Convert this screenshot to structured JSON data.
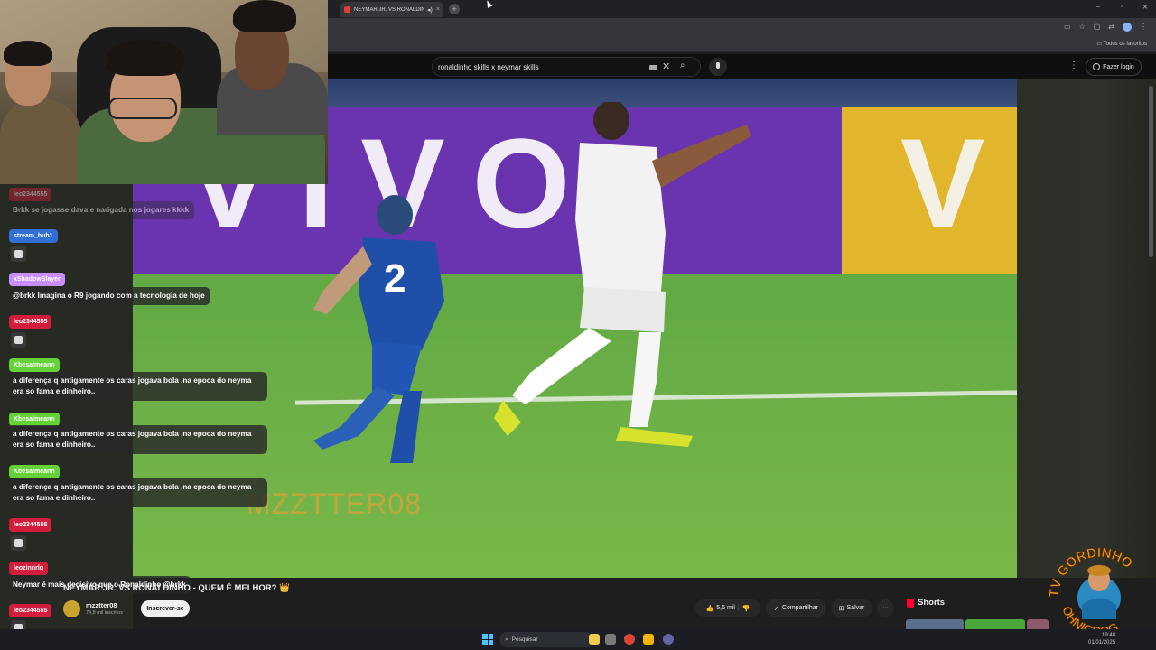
{
  "browser": {
    "tab_title": "NEYMAR JR. VS RONALDIN",
    "new_tab": "+",
    "tab_close": "×",
    "window_min": "–",
    "window_max": "▫",
    "window_close": "✕",
    "bookmarks_all": "Todos os favoritos"
  },
  "youtube": {
    "search_value": "ronaldinho skills x neymar skills",
    "login_label": "Fazer login",
    "kebab": "⋮",
    "video_title": "NEYMAR JR. VS RONALDINHO - QUEM É MELHOR? 👑",
    "channel_name": "mzztter08",
    "channel_subs": "74,8 mil inscritos",
    "subscribe_label": "Inscrever-se",
    "likes": "5,6 mil",
    "share_label": "Compartilhar",
    "save_label": "Salvar",
    "more": "···",
    "shorts_label": "Shorts",
    "watermark": "MZZTTER08"
  },
  "video_scene": {
    "board_text_left": "VIVO",
    "board_text_right": "V"
  },
  "chat": {
    "messages": [
      {
        "user": "leo2344555",
        "text": "Brkk se jogasse dava e narigada nos jogares kkkk",
        "user_color": "#d31d3d"
      },
      {
        "user": "stream_hub1",
        "text": "",
        "user_color": "#2f6fd6"
      },
      {
        "user": "xShadowSlayer",
        "text": "@brkk Imagina o R9 jogando com a tecnologia de hoje",
        "user_color": "#c88dff"
      },
      {
        "user": "leo2344555",
        "text": "",
        "user_color": "#d31d3d"
      },
      {
        "user": "Kbesalmeann",
        "text": "a diferença q antigamente os caras jogava bola ,na epoca do neyma era so fama e dinheiro..",
        "user_color": "#66d23a"
      },
      {
        "user": "Kbesalmeann",
        "text": "a diferença q antigamente os caras jogava bola ,na epoca do neyma era so fama e dinheiro..",
        "user_color": "#66d23a"
      },
      {
        "user": "Kbesalmeann",
        "text": "a diferença q antigamente os caras jogava bola ,na epoca do neyma era so fama e dinheiro..",
        "user_color": "#66d23a"
      },
      {
        "user": "leo2344555",
        "text": "",
        "user_color": "#d31d3d"
      },
      {
        "user": "leozinnrlq",
        "text": "Neymar é mais decisivo que o Ronaldinho @brkk",
        "user_color": "#d31d3d"
      },
      {
        "user": "leo2344555",
        "text": "",
        "user_color": "#d31d3d"
      }
    ]
  },
  "overlay_logo": {
    "text_top": "TV GORDINHO",
    "text_side": "TV",
    "text_bottom": "OHNIGROG"
  },
  "taskbar": {
    "search_placeholder": "Pesquisar",
    "time": "19:48",
    "date": "01/01/2025"
  },
  "colors": {
    "youtube_red": "#ff0033",
    "chat_red": "#d31d3d",
    "chat_green": "#66d23a",
    "chat_blue": "#2f6fd6",
    "chat_lilac": "#c88dff"
  }
}
